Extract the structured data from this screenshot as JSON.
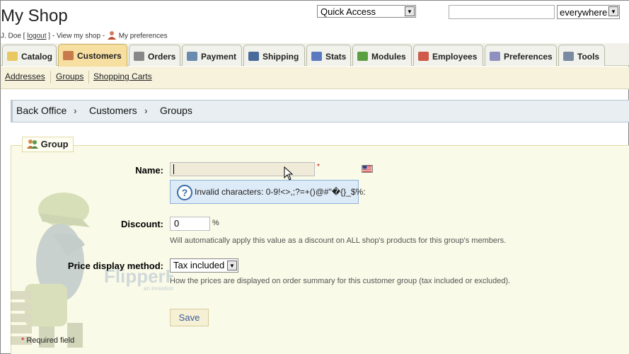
{
  "header": {
    "shop_title": "My Shop",
    "user": "J. Doe [",
    "logout": "logout",
    "user_tail": "] - View my shop -",
    "my_preferences": "My preferences",
    "quick_access": "Quick Access",
    "search_value": "",
    "search_scope": "everywhere"
  },
  "tabs": [
    {
      "label": "Catalog",
      "icon": "folder-icon",
      "color": "#e8c860"
    },
    {
      "label": "Customers",
      "icon": "customer-icon",
      "color": "#c97a4a"
    },
    {
      "label": "Orders",
      "icon": "cart-icon",
      "color": "#888888"
    },
    {
      "label": "Payment",
      "icon": "payment-icon",
      "color": "#6a8ab0"
    },
    {
      "label": "Shipping",
      "icon": "truck-icon",
      "color": "#4a6a9a"
    },
    {
      "label": "Stats",
      "icon": "stats-icon",
      "color": "#5a7ac0"
    },
    {
      "label": "Modules",
      "icon": "puzzle-icon",
      "color": "#5aa040"
    },
    {
      "label": "Employees",
      "icon": "employee-icon",
      "color": "#d05a4a"
    },
    {
      "label": "Preferences",
      "icon": "preferences-icon",
      "color": "#9090c0"
    },
    {
      "label": "Tools",
      "icon": "wrench-icon",
      "color": "#7a8aa0"
    }
  ],
  "active_tab": "Customers",
  "subnav": [
    "Addresses",
    "Groups",
    "Shopping Carts"
  ],
  "breadcrumb": [
    "Back Office",
    "Customers",
    "Groups"
  ],
  "form": {
    "legend": "Group",
    "name_label": "Name:",
    "name_value": "",
    "required_star": "*",
    "hint": "Invalid characters: 0-9!<>,;?=+()@#\"�{}_$%:",
    "discount_label": "Discount:",
    "discount_value": "0",
    "discount_unit": "%",
    "discount_help": "Will automatically apply this value as a discount on ALL shop's products for this group's members.",
    "price_label": "Price display method:",
    "price_value": "Tax included",
    "price_help": "How the prices are displayed on order summary for this customer group (tax included or excluded).",
    "save": "Save",
    "required_note": "Required field"
  },
  "watermark": {
    "line1": "FlipperHost",
    "line2": "an investion company"
  }
}
